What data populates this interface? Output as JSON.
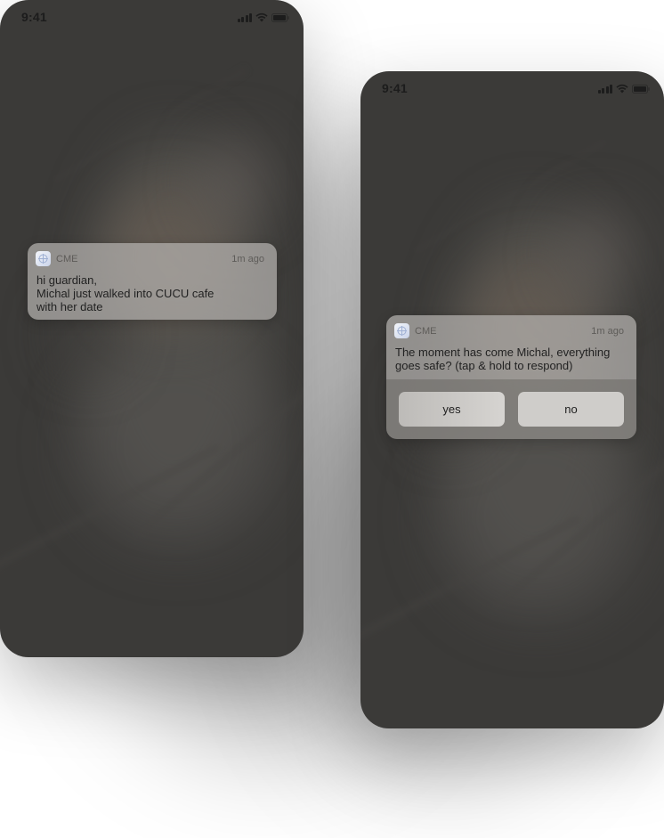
{
  "screens": [
    {
      "status_bar": {
        "time": "9:41"
      },
      "notification": {
        "app_name": "CME",
        "time_ago": "1m ago",
        "body_lines": [
          "hi guardian,",
          "Michal just walked into CUCU cafe",
          "with her date"
        ]
      }
    },
    {
      "status_bar": {
        "time": "9:41"
      },
      "notification": {
        "app_name": "CME",
        "time_ago": "1m ago",
        "body_lines": [
          "The moment has come Michal, everything",
          "goes safe? (tap & hold to respond)"
        ],
        "actions": [
          {
            "label": "yes"
          },
          {
            "label": "no"
          }
        ]
      }
    }
  ],
  "icons": {
    "app_icon": "app-logo-icon",
    "signal": "signal-icon",
    "wifi": "wifi-icon",
    "battery": "battery-icon"
  },
  "colors": {
    "phone_background": "#3b3a38",
    "notification_background": "#b4b2ae",
    "action_button": "#cfcdca"
  }
}
